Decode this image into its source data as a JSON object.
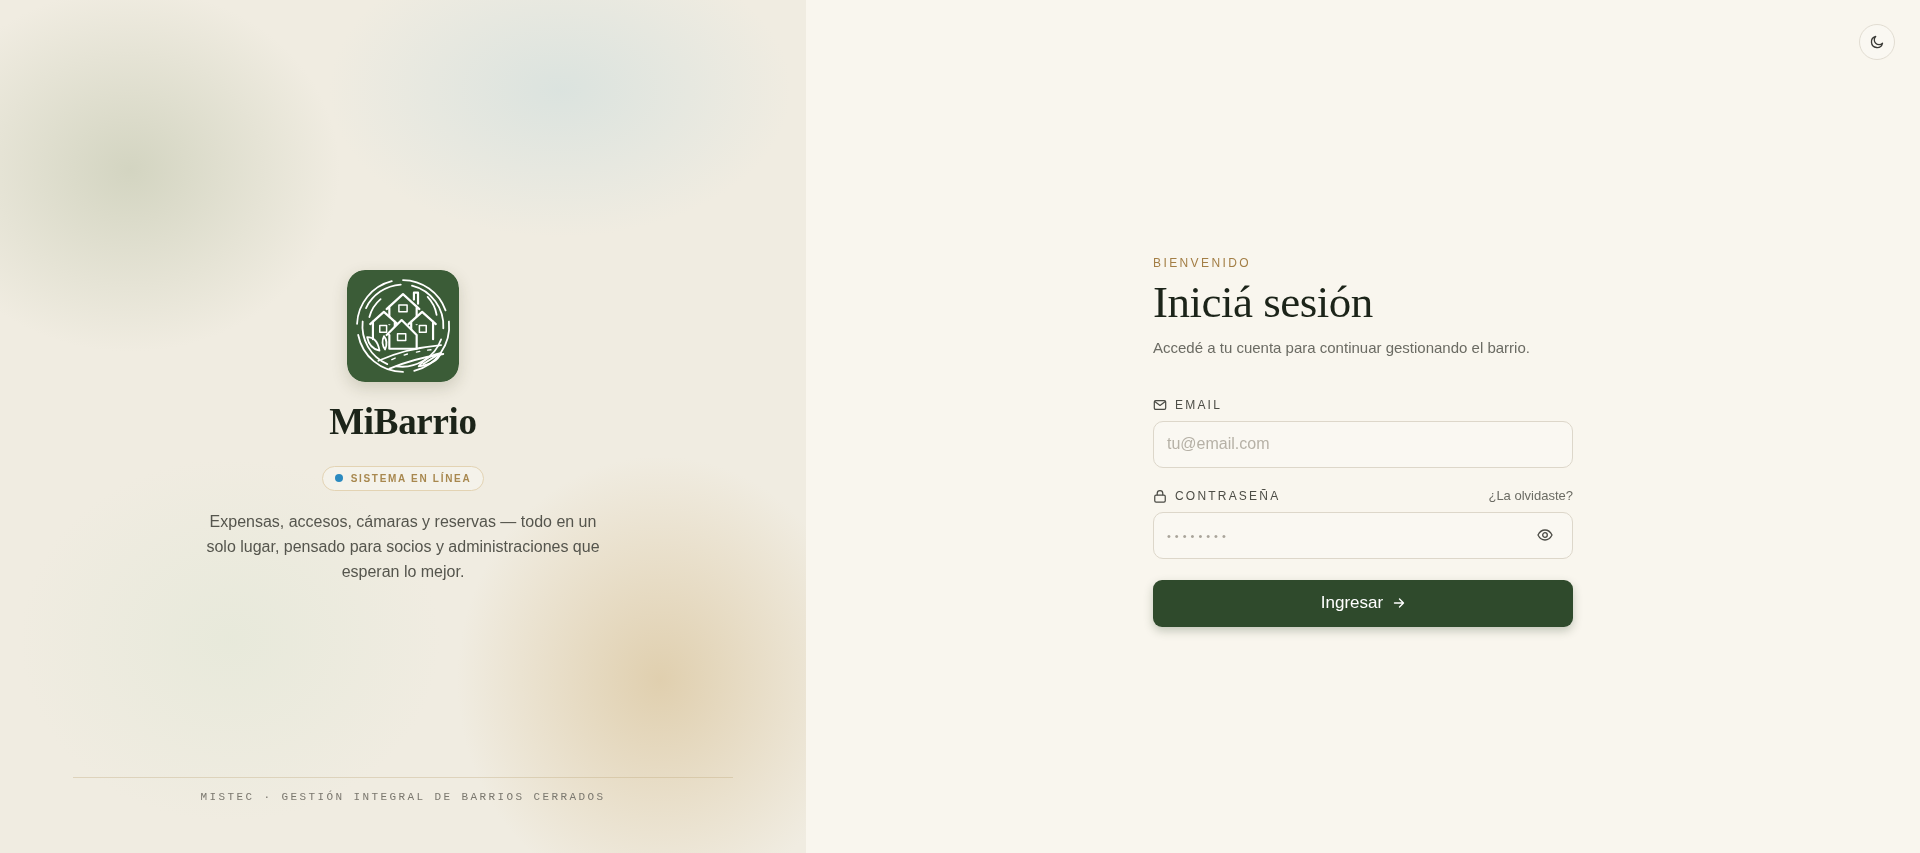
{
  "brand": {
    "name": "MiBarrio",
    "status": "SISTEMA EN LÍNEA",
    "tagline": "Expensas, accesos, cámaras y reservas — todo en un solo lugar, pensado para socios y administraciones que esperan lo mejor.",
    "footer": "MISTEC · GESTIÓN INTEGRAL DE BARRIOS CERRADOS"
  },
  "login": {
    "eyebrow": "BIENVENIDO",
    "title": "Iniciá sesión",
    "subtitle": "Accedé a tu cuenta para continuar gestionando el barrio.",
    "fields": [
      {
        "kind": "email",
        "label": "EMAIL",
        "placeholder": "tu@email.com"
      },
      {
        "kind": "password",
        "label": "CONTRASEÑA",
        "link": "¿La olvidaste?",
        "placeholder": "••••••••"
      }
    ],
    "submit": "Ingresar"
  }
}
